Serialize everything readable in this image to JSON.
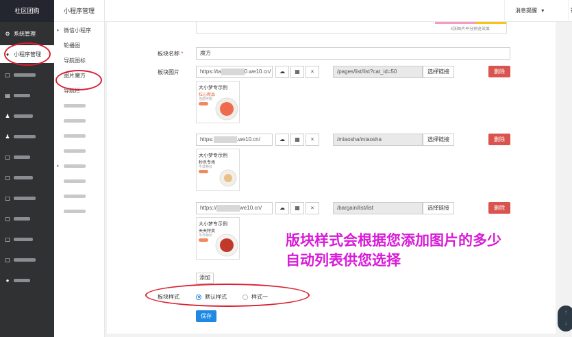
{
  "sidebar": {
    "brand": "社区团购",
    "items": [
      {
        "label": "系统管理",
        "icon": "gear-icon",
        "glyph": "⚙",
        "active": false
      },
      {
        "label": "小程序管理",
        "icon": "pin-icon",
        "glyph": "♦",
        "active": true
      },
      {
        "label": "",
        "icon": "icon",
        "glyph": "▢",
        "active": false
      },
      {
        "label": "",
        "icon": "icon",
        "glyph": "▤",
        "active": false
      },
      {
        "label": "",
        "icon": "icon",
        "glyph": "♟",
        "active": false
      },
      {
        "label": "",
        "icon": "icon",
        "glyph": "♟",
        "active": false
      },
      {
        "label": "",
        "icon": "icon",
        "glyph": "▢",
        "active": false
      },
      {
        "label": "",
        "icon": "icon",
        "glyph": "▢",
        "active": false
      },
      {
        "label": "",
        "icon": "icon",
        "glyph": "▢",
        "active": false
      },
      {
        "label": "",
        "icon": "icon",
        "glyph": "▢",
        "active": false
      },
      {
        "label": "",
        "icon": "icon",
        "glyph": "▢",
        "active": false
      },
      {
        "label": "",
        "icon": "icon",
        "glyph": "▢",
        "active": false
      },
      {
        "label": "",
        "icon": "icon",
        "glyph": "●",
        "active": false
      }
    ]
  },
  "subnav": {
    "title": "小程序管理",
    "items": [
      {
        "label": "微信小程序",
        "caret": true
      },
      {
        "label": "轮播图",
        "caret": false
      },
      {
        "label": "导航图标",
        "caret": false
      },
      {
        "label": "图片魔方",
        "caret": false
      },
      {
        "label": "导航栏",
        "caret": false
      },
      {
        "label": "",
        "caret": false
      },
      {
        "label": "",
        "caret": false
      },
      {
        "label": "",
        "caret": false
      },
      {
        "label": "",
        "caret": false
      },
      {
        "label": "",
        "caret": true
      },
      {
        "label": "",
        "caret": false
      },
      {
        "label": "",
        "caret": false
      },
      {
        "label": "",
        "caret": false
      }
    ]
  },
  "header": {
    "messages": "消息提醒",
    "messages_caret": "▾",
    "cut_label": "社"
  },
  "preview_note": "4张图片平分预览效果",
  "form": {
    "name_label": "板块名称",
    "required_mark": "*",
    "name_value": "魔方",
    "image_label": "板块图片",
    "style_label": "板块样式",
    "add_button": "添加",
    "save_button": "保存"
  },
  "image_rows": [
    {
      "url_prefix": "https://ta",
      "url_suffix": "0.we10.cn/",
      "link": "/pages/list/list?cat_id=50",
      "thumb_title": "大小梦专示例",
      "thumb_sub": "拉心新品",
      "thumb_sub2": "当前可购"
    },
    {
      "url_prefix": "https:",
      "url_suffix": ".we10.cn/",
      "link": "/miaosha/miaosha",
      "thumb_title": "大小梦专示例",
      "thumb_sub": "秒杀专场",
      "thumb_sub2": "今日特价"
    },
    {
      "url_prefix": "https://",
      "url_suffix": "we10.cn/",
      "link": "/bargain/list/list",
      "thumb_title": "大小梦专示例",
      "thumb_sub": "天天特卖",
      "thumb_sub2": "今日特价"
    }
  ],
  "buttons": {
    "upload_glyph": "☁",
    "grid_glyph": "▦",
    "close_glyph": "×",
    "select_link": "选择链接",
    "delete": "删除"
  },
  "style_options": [
    {
      "label": "默认样式",
      "selected": true
    },
    {
      "label": "样式一",
      "selected": false
    }
  ],
  "annotation": {
    "line1": "版块样式会根据您添加图片的多少",
    "line2": "自动列表供您选择"
  },
  "scroll": {
    "up": "↑",
    "down": "↓"
  },
  "colors": {
    "primary": "#1e88e5",
    "danger": "#d9534f",
    "annotation": "#d81bd8",
    "highlight_ring": "#d9202e"
  }
}
